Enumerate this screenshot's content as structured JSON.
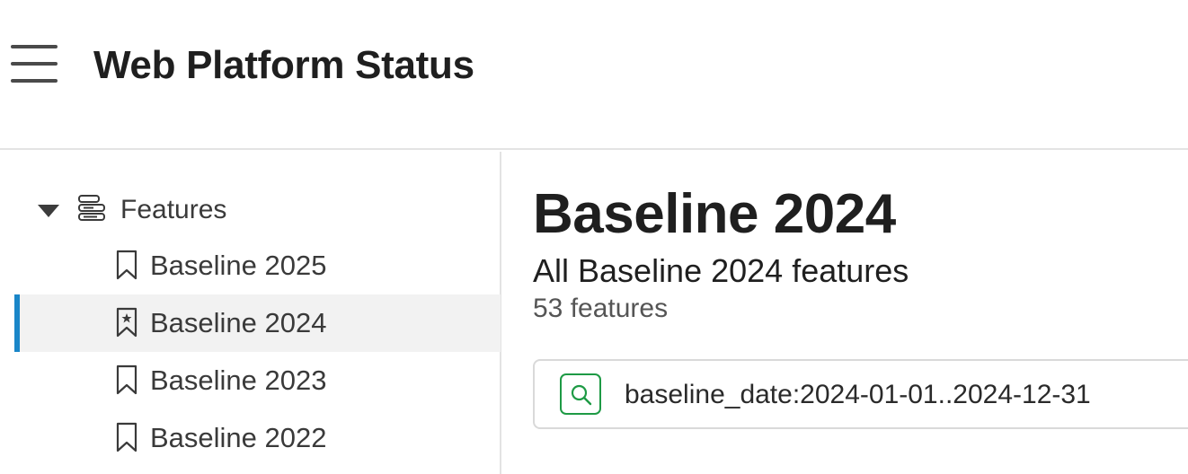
{
  "header": {
    "menu_icon": "hamburger-menu-icon",
    "title": "Web Platform Status"
  },
  "sidebar": {
    "section": {
      "label": "Features",
      "expanded": true,
      "icon": "features-list-icon"
    },
    "items": [
      {
        "label": "Baseline 2025",
        "icon": "bookmark-icon",
        "active": false
      },
      {
        "label": "Baseline 2024",
        "icon": "bookmark-star-icon",
        "active": true
      },
      {
        "label": "Baseline 2023",
        "icon": "bookmark-icon",
        "active": false
      },
      {
        "label": "Baseline 2022",
        "icon": "bookmark-icon",
        "active": false
      }
    ],
    "active_indicator_color": "#1a86c8"
  },
  "main": {
    "title": "Baseline 2024",
    "subtitle": "All Baseline 2024 features",
    "count": "53 features",
    "search": {
      "icon": "search-icon",
      "value": "baseline_date:2024-01-01..2024-12-31",
      "icon_color": "#1e9a45"
    }
  }
}
